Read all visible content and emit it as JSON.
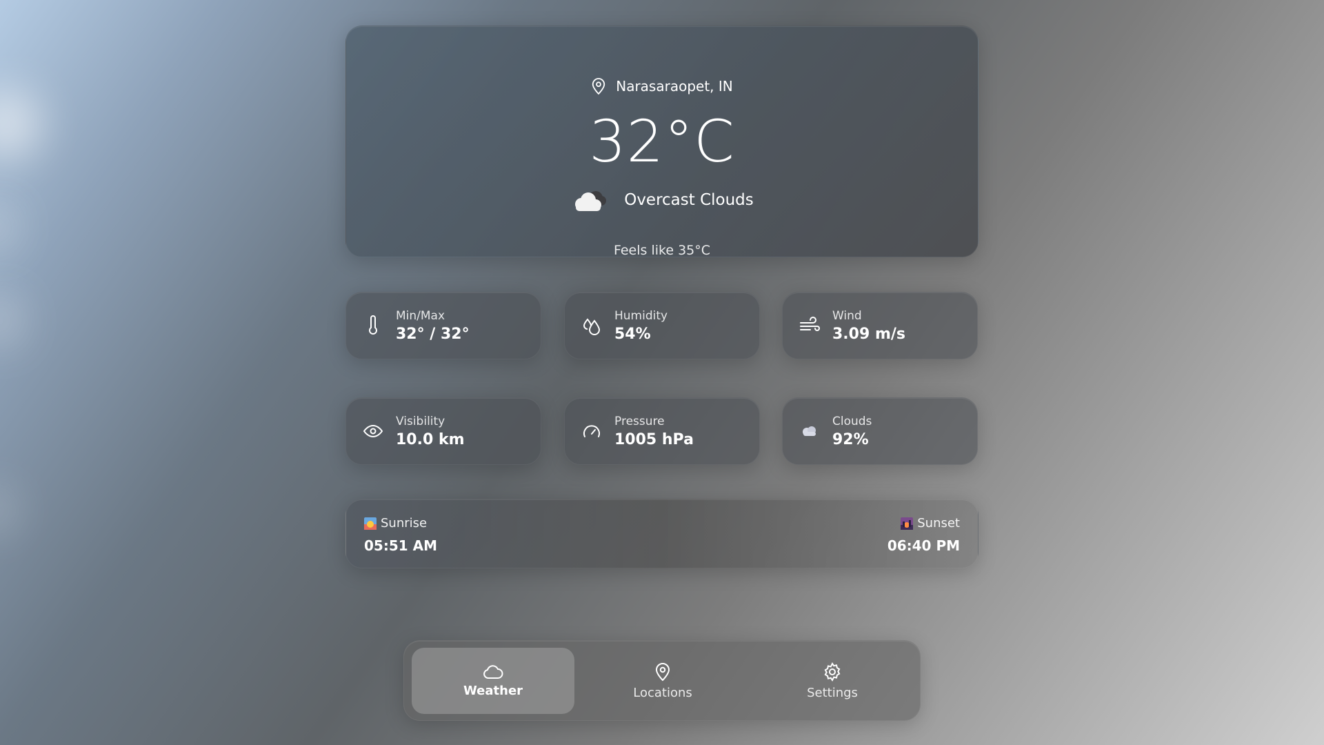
{
  "location": {
    "name": "Narasaraopet, IN",
    "icon": "map-pin-icon"
  },
  "current": {
    "temperature": "32°C",
    "condition": "Overcast Clouds",
    "condition_icon": "cloud-icon",
    "feels_like": "Feels like 35°C"
  },
  "stats": [
    {
      "label": "Min/Max",
      "value": "32° / 32°",
      "icon": "thermometer-icon"
    },
    {
      "label": "Humidity",
      "value": "54%",
      "icon": "droplets-icon"
    },
    {
      "label": "Wind",
      "value": "3.09 m/s",
      "icon": "wind-icon"
    },
    {
      "label": "Visibility",
      "value": "10.0 km",
      "icon": "eye-icon"
    },
    {
      "label": "Pressure",
      "value": "1005 hPa",
      "icon": "gauge-icon"
    },
    {
      "label": "Clouds",
      "value": "92%",
      "icon": "cloud-icon"
    }
  ],
  "sun": {
    "sunrise_label": "Sunrise",
    "sunrise_time": "05:51 AM",
    "sunset_label": "Sunset",
    "sunset_time": "06:40 PM"
  },
  "nav": {
    "items": [
      {
        "label": "Weather",
        "icon": "cloud-icon",
        "active": true
      },
      {
        "label": "Locations",
        "icon": "map-pin-icon",
        "active": false
      },
      {
        "label": "Settings",
        "icon": "gear-icon",
        "active": false
      }
    ]
  }
}
